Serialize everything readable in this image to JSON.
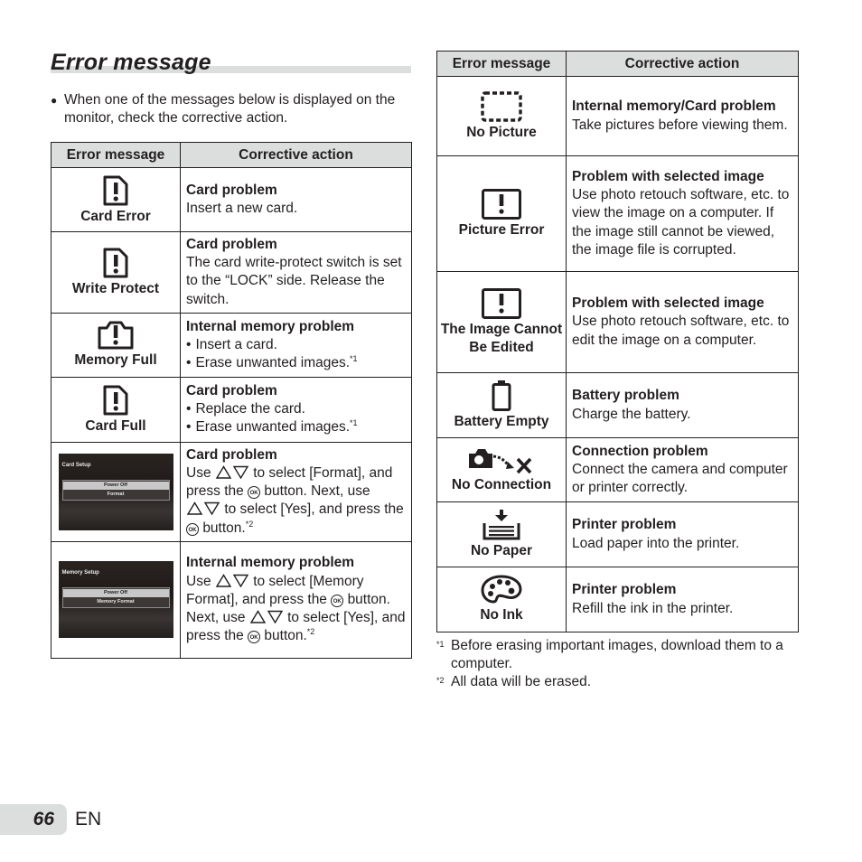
{
  "page": {
    "title": "Error message",
    "intro": "When one of the messages below is displayed on the monitor, check the corrective action.",
    "page_number": "66",
    "language": "EN"
  },
  "table_headers": {
    "message": "Error message",
    "action": "Corrective action"
  },
  "left_rows": [
    {
      "icon": "card-exclamation-icon",
      "message": "Card Error",
      "heading": "Card problem",
      "body": "Insert a new card."
    },
    {
      "icon": "card-exclamation-icon",
      "message": "Write Protect",
      "heading": "Card problem",
      "body": "The card write-protect switch is set to the “LOCK” side. Release the switch."
    },
    {
      "icon": "memory-exclamation-icon",
      "message": "Memory Full",
      "heading": "Internal memory problem",
      "bullets": [
        "Insert a card.",
        "Erase unwanted images."
      ],
      "bullet2_note": "*1"
    },
    {
      "icon": "card-exclamation-icon",
      "message": "Card Full",
      "heading": "Card problem",
      "bullets": [
        "Replace the card.",
        "Erase unwanted images."
      ],
      "bullet2_note": "*1"
    },
    {
      "screen": {
        "title": "Card Setup",
        "options": [
          "Power Off",
          "Format"
        ]
      },
      "heading": "Card problem",
      "parts": [
        "Use",
        "to select [Format], and press the",
        "button. Next, use",
        "to select [Yes], and press the",
        "button."
      ],
      "note": "*2"
    },
    {
      "screen": {
        "title": "Memory Setup",
        "options": [
          "Power Off",
          "Memory Format"
        ]
      },
      "heading": "Internal memory problem",
      "parts": [
        "Use",
        "to select [Memory Format], and press the",
        "button. Next, use",
        "to select [Yes], and press the",
        "button."
      ],
      "note": "*2"
    }
  ],
  "right_rows": [
    {
      "icon": "dashed-frame-icon",
      "message": "No Picture",
      "heading": "Internal memory/Card problem",
      "body": "Take pictures before viewing them."
    },
    {
      "icon": "frame-exclamation-icon",
      "message": "Picture Error",
      "heading": "Problem with selected image",
      "body": "Use photo retouch software, etc. to view the image on a computer. If the image still cannot be viewed, the image file is corrupted."
    },
    {
      "icon": "frame-exclamation-icon",
      "message": "The Image Cannot Be Edited",
      "heading": "Problem with selected image",
      "body": "Use photo retouch software, etc. to edit the image on a computer."
    },
    {
      "icon": "battery-empty-icon",
      "message": "Battery Empty",
      "heading": "Battery problem",
      "body": "Charge the battery."
    },
    {
      "icon": "camera-disconnected-icon",
      "message": "No Connection",
      "heading": "Connection problem",
      "body": "Connect the camera and computer or printer correctly."
    },
    {
      "icon": "paper-tray-icon",
      "message": "No Paper",
      "heading": "Printer problem",
      "body": "Load paper into the printer."
    },
    {
      "icon": "ink-palette-icon",
      "message": "No Ink",
      "heading": "Printer problem",
      "body": "Refill the ink in the printer."
    }
  ],
  "footnotes": [
    {
      "mark": "*1",
      "text": "Before erasing important images, download them to a computer."
    },
    {
      "mark": "*2",
      "text": "All data will be erased."
    }
  ],
  "symbols": {
    "ok": "OK"
  }
}
